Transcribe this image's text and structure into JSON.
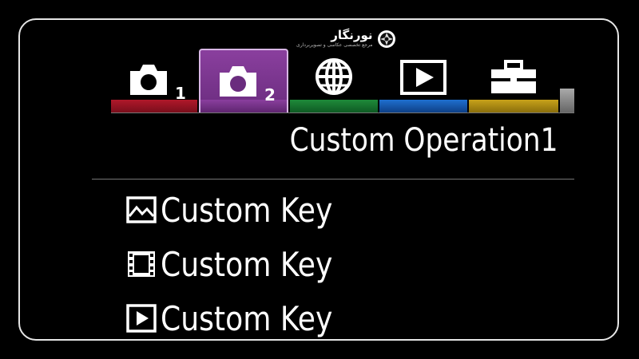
{
  "watermark": {
    "name": "نورنگار",
    "tagline": "مرجع تخصصی عکاسی و تصویربرداری"
  },
  "tabs": [
    {
      "name": "shooting-1",
      "icon": "camera-icon",
      "number": "1",
      "color": "#b0182a",
      "selected": false
    },
    {
      "name": "shooting-2",
      "icon": "camera-icon",
      "number": "2",
      "color": "#8a3f9e",
      "selected": true
    },
    {
      "name": "network",
      "icon": "globe-icon",
      "number": "",
      "color": "#1e8a3a",
      "selected": false
    },
    {
      "name": "playback",
      "icon": "play-icon",
      "number": "",
      "color": "#1f6fd0",
      "selected": false
    },
    {
      "name": "setup",
      "icon": "toolbox-icon",
      "number": "",
      "color": "#c8a21a",
      "selected": false
    }
  ],
  "page": {
    "title": "Custom Operation1"
  },
  "items": [
    {
      "icon": "still-image-icon",
      "label": "Custom Key"
    },
    {
      "icon": "movie-film-icon",
      "label": "Custom Key"
    },
    {
      "icon": "playback-icon",
      "label": "Custom Key"
    }
  ]
}
